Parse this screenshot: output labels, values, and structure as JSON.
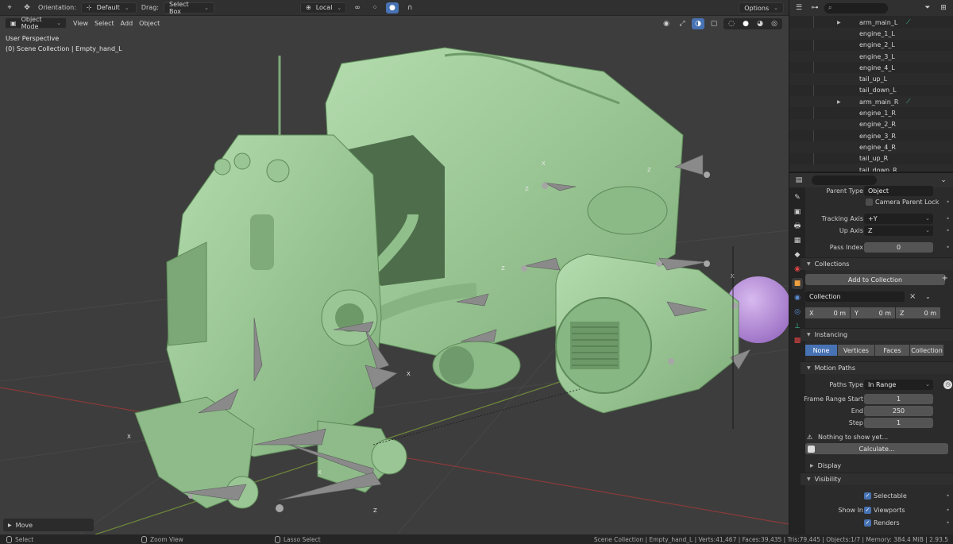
{
  "header": {
    "orientation_label": "Orientation:",
    "orientation_value": "Default",
    "drag_label": "Drag:",
    "drag_value": "Select Box",
    "pivot_value": "Local",
    "options_label": "Options"
  },
  "viewport": {
    "mode": "Object Mode",
    "menus": [
      "View",
      "Select",
      "Add",
      "Object"
    ],
    "perspective": "User Perspective",
    "collection_info": "(0) Scene Collection | Empty_hand_L",
    "last_op": "Move"
  },
  "outliner": {
    "items": [
      {
        "label": "arm_main_L",
        "expandable": true,
        "bone": true
      },
      {
        "label": "engine_1_L",
        "expandable": false,
        "bone": false
      },
      {
        "label": "engine_2_L",
        "expandable": false,
        "bone": false
      },
      {
        "label": "engine_3_L",
        "expandable": false,
        "bone": false
      },
      {
        "label": "engine_4_L",
        "expandable": false,
        "bone": false
      },
      {
        "label": "tail_up_L",
        "expandable": false,
        "bone": false
      },
      {
        "label": "tail_down_L",
        "expandable": false,
        "bone": false
      },
      {
        "label": "arm_main_R",
        "expandable": true,
        "bone": true
      },
      {
        "label": "engine_1_R",
        "expandable": false,
        "bone": false
      },
      {
        "label": "engine_2_R",
        "expandable": false,
        "bone": false
      },
      {
        "label": "engine_3_R",
        "expandable": false,
        "bone": false
      },
      {
        "label": "engine_4_R",
        "expandable": false,
        "bone": false
      },
      {
        "label": "tail_up_R",
        "expandable": false,
        "bone": false
      },
      {
        "label": "tail_down_R",
        "expandable": false,
        "bone": false
      }
    ]
  },
  "properties": {
    "parent_type_label": "Parent Type",
    "parent_type_value": "Object",
    "camera_parent_lock": "Camera Parent Lock",
    "tracking_axis_label": "Tracking Axis",
    "tracking_axis_value": "+Y",
    "up_axis_label": "Up Axis",
    "up_axis_value": "Z",
    "pass_index_label": "Pass Index",
    "pass_index_value": "0",
    "collections_title": "Collections",
    "add_to_collection": "Add to Collection",
    "collection_name": "Collection",
    "offset": {
      "x_label": "X",
      "x_value": "0 m",
      "y_label": "Y",
      "y_value": "0 m",
      "z_label": "Z",
      "z_value": "0 m"
    },
    "instancing_title": "Instancing",
    "instancing_options": [
      "None",
      "Vertices",
      "Faces",
      "Collection"
    ],
    "instancing_selected": "None",
    "motion_paths_title": "Motion Paths",
    "paths_type_label": "Paths Type",
    "paths_type_value": "In Range",
    "frame_start_label": "Frame Range Start",
    "frame_start_value": "1",
    "end_label": "End",
    "end_value": "250",
    "step_label": "Step",
    "step_value": "1",
    "nothing_to_show": "Nothing to show yet...",
    "calculate": "Calculate...",
    "display_title": "Display",
    "visibility_title": "Visibility",
    "selectable": "Selectable",
    "show_in_label": "Show In",
    "viewports": "Viewports",
    "renders": "Renders"
  },
  "statusbar": {
    "select": "Select",
    "zoom_view": "Zoom View",
    "lasso_select": "Lasso Select",
    "stats": "Scene Collection | Empty_hand_L | Verts:41,467 | Faces:39,435 | Tris:79,445 | Objects:1/7 | Memory: 384.4 MiB | 2.93.5"
  },
  "colors": {
    "model": "#97c592",
    "accent": "#4772b3",
    "bone": "#3fc8a0",
    "sphere": "#b78fd6",
    "viewport_bg": "#3d3d3d"
  }
}
